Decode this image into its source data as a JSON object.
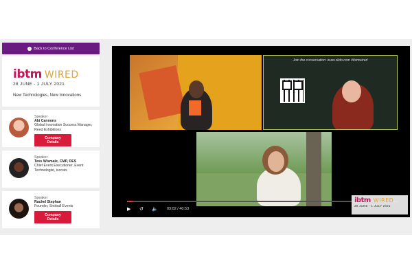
{
  "sidebar": {
    "back_label": "Back to Conference List",
    "brand": {
      "logo_main": "ibtm",
      "logo_sub": "WIRED",
      "dates": "28 JUNE - 1 JULY 2021",
      "tagline": "New Technologies, New Innovations"
    },
    "speakers": [
      {
        "role": "Speaker",
        "name": "Abi Cannons",
        "title": "Global Innovation Success Manager, Reed Exhibitions",
        "button": "Company Details"
      },
      {
        "role": "Speaker",
        "name": "Tess Wismale, CMP, DES",
        "title": "Chief Event Executioner, Event Technologist, isocatx",
        "button": ""
      },
      {
        "role": "Speaker",
        "name": "Rachel Stephan",
        "title": "Founder, Snoball Events",
        "button": "Company Details"
      }
    ]
  },
  "player": {
    "tile_b_caption": "Join the conversation: www.slido.com #ibtmwired",
    "time_current": "03:02",
    "time_separator": "/",
    "time_total": "40:53",
    "progress": 0.02,
    "corner_logo": {
      "logo_main": "ibtm",
      "logo_sub": "WIRED",
      "dates": "28 JUNE - 1 JULY 2021"
    }
  },
  "colors": {
    "accent": "#6a1b7f",
    "button": "#d81b3a",
    "brand_pink": "#c2185b",
    "brand_gold": "#e0a13a"
  },
  "icons": {
    "back": "back-arrow-icon",
    "play": "play-icon",
    "loop": "loop-icon",
    "volume": "volume-icon"
  }
}
